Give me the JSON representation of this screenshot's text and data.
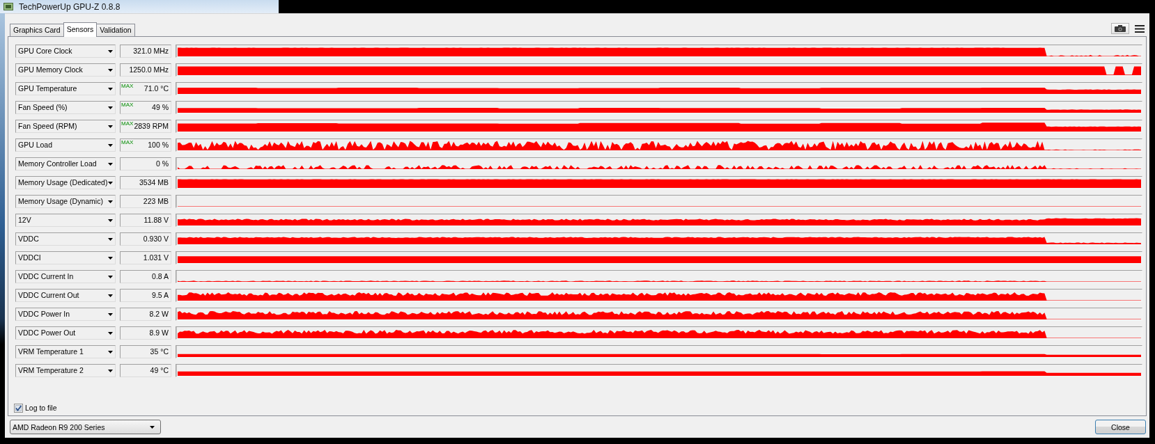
{
  "window": {
    "title": "TechPowerUp GPU-Z 0.8.8"
  },
  "tabs": [
    {
      "label": "Graphics Card",
      "selected": false
    },
    {
      "label": "Sensors",
      "selected": true
    },
    {
      "label": "Validation",
      "selected": false
    }
  ],
  "sensors": [
    {
      "name": "GPU Core Clock",
      "reading": "321.0 MHz"
    },
    {
      "name": "GPU Memory Clock",
      "reading": "1250.0 MHz"
    },
    {
      "name": "GPU Temperature",
      "mode": "MAX",
      "reading": "71.0 °C"
    },
    {
      "name": "Fan Speed (%)",
      "mode": "MAX",
      "reading": "49 %"
    },
    {
      "name": "Fan Speed (RPM)",
      "mode": "MAX",
      "reading": "2839 RPM"
    },
    {
      "name": "GPU Load",
      "mode": "MAX",
      "reading": "100 %"
    },
    {
      "name": "Memory Controller Load",
      "reading": "0 %"
    },
    {
      "name": "Memory Usage (Dedicated)",
      "reading": "3534 MB"
    },
    {
      "name": "Memory Usage (Dynamic)",
      "reading": "223 MB"
    },
    {
      "name": "12V",
      "reading": "11.88 V"
    },
    {
      "name": "VDDC",
      "reading": "0.930 V"
    },
    {
      "name": "VDDCI",
      "reading": "1.031 V"
    },
    {
      "name": "VDDC Current In",
      "reading": "0.8 A"
    },
    {
      "name": "VDDC Current Out",
      "reading": "9.5 A"
    },
    {
      "name": "VDDC Power In",
      "reading": "8.2 W"
    },
    {
      "name": "VDDC Power Out",
      "reading": "8.9 W"
    },
    {
      "name": "VRM Temperature 1",
      "reading": "35 °C"
    },
    {
      "name": "VRM Temperature 2",
      "reading": "49 °C"
    }
  ],
  "log_to_file": {
    "label": "Log to file",
    "checked": true
  },
  "device_select": {
    "value": "AMD Radeon R9 200 Series"
  },
  "close_button": {
    "label": "Close"
  }
}
